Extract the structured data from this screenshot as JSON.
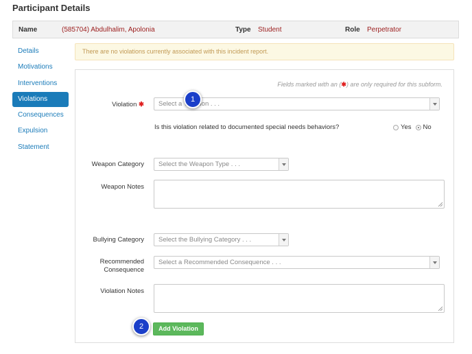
{
  "page": {
    "title": "Participant Details"
  },
  "participant": {
    "name_label": "Name",
    "name_value": "(585704) Abdulhalim, Apolonia",
    "type_label": "Type",
    "type_value": "Student",
    "role_label": "Role",
    "role_value": "Perpetrator"
  },
  "sidebar": {
    "items": [
      {
        "label": "Details",
        "active": false
      },
      {
        "label": "Motivations",
        "active": false
      },
      {
        "label": "Interventions",
        "active": false
      },
      {
        "label": "Violations",
        "active": true
      },
      {
        "label": "Consequences",
        "active": false
      },
      {
        "label": "Expulsion",
        "active": false
      },
      {
        "label": "Statement",
        "active": false
      }
    ]
  },
  "alert": {
    "text": "There are no violations currently associated with this incident report."
  },
  "form": {
    "required_note_prefix": "Fields marked with an (",
    "required_note_star": "✱",
    "required_note_suffix": ") are only required for this subform.",
    "violation": {
      "label": "Violation",
      "placeholder": "Select a Violation . . ."
    },
    "special_needs": {
      "question": "Is this violation related to documented special needs behaviors?",
      "yes_label": "Yes",
      "no_label": "No",
      "selected": "No"
    },
    "weapon_category": {
      "label": "Weapon Category",
      "placeholder": "Select the Weapon Type . . ."
    },
    "weapon_notes": {
      "label": "Weapon Notes"
    },
    "bullying_category": {
      "label": "Bullying Category",
      "placeholder": "Select the Bullying Category . . ."
    },
    "recommended_consequence": {
      "label_line1": "Recommended",
      "label_line2": "Consequence",
      "placeholder": "Select a Recommended Consequence . . ."
    },
    "violation_notes": {
      "label": "Violation Notes"
    },
    "add_button": "Add Violation"
  },
  "callouts": {
    "one": "1",
    "two": "2"
  },
  "colors": {
    "link": "#1a7bb9",
    "required": "#e02020",
    "value_red": "#9b1c1c",
    "button_green": "#5cb85c",
    "callout_blue": "#1b3fc9"
  }
}
